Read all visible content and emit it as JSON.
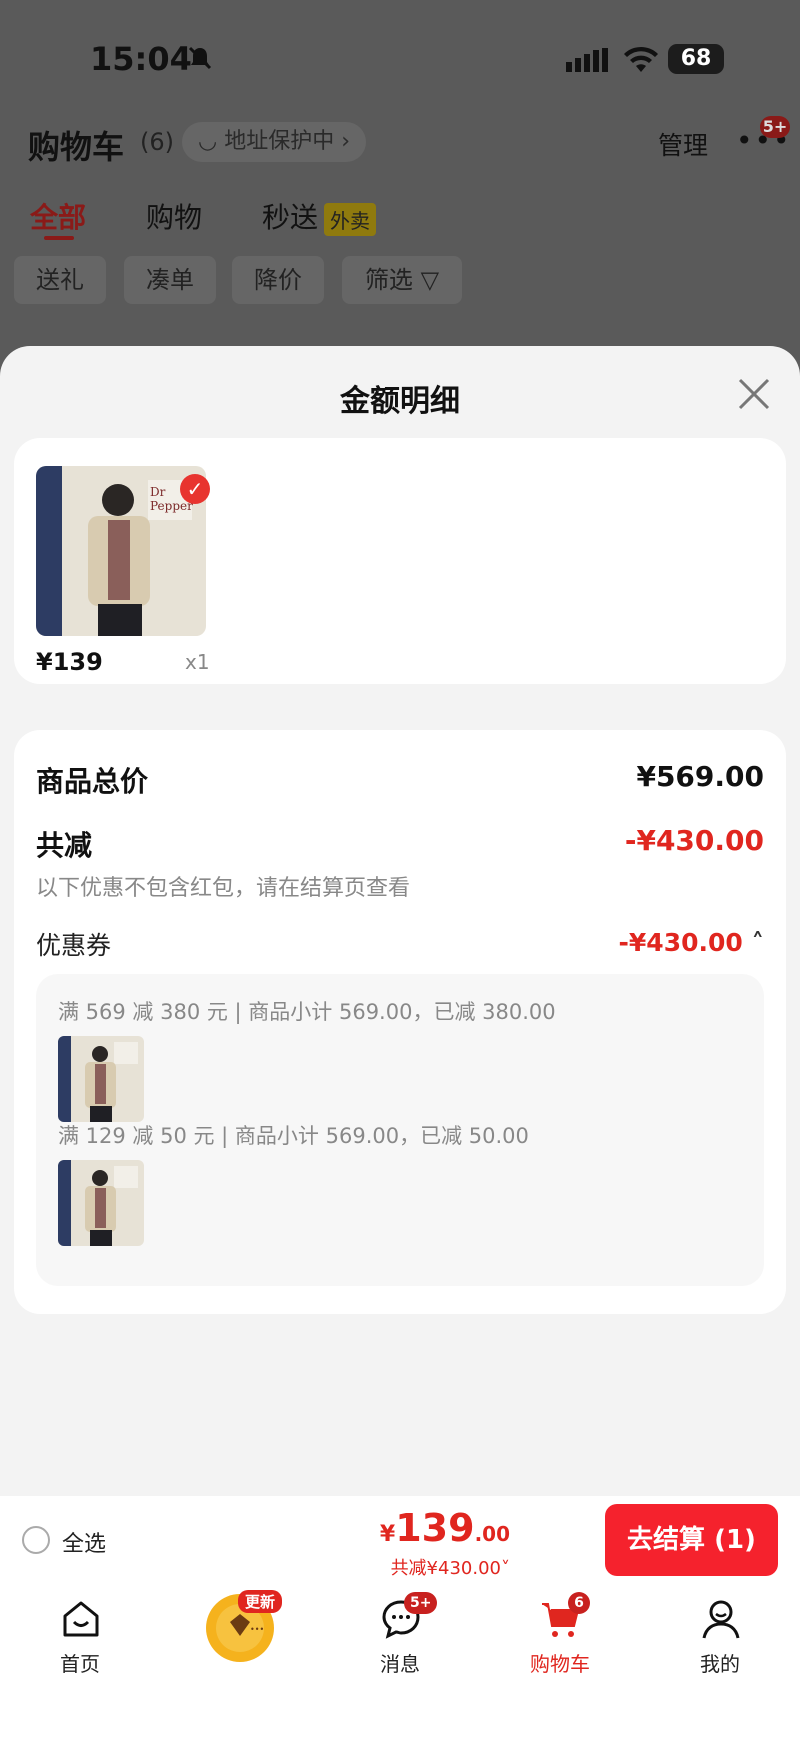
{
  "status_bar": {
    "time": "15:04",
    "battery": "68"
  },
  "header": {
    "title": "购物车",
    "count": "(6)",
    "address": "地址保护中",
    "manage": "管理",
    "more_badge": "5+"
  },
  "tabs": [
    {
      "label": "全部"
    },
    {
      "label": "购物"
    },
    {
      "label": "秒送"
    }
  ],
  "takeout_tag": "外卖",
  "chips": [
    {
      "label": "送礼"
    },
    {
      "label": "凑单"
    },
    {
      "label": "降价"
    },
    {
      "label": "筛选"
    }
  ],
  "sheet": {
    "title": "金额明细",
    "item": {
      "price": "¥139",
      "qty": "x1"
    },
    "summary": {
      "total_label": "商品总价",
      "total_value": "¥569.00",
      "reduce_label": "共减",
      "reduce_value": "-¥430.00",
      "note": "以下优惠不包含红包，请在结算页查看",
      "coupon_label": "优惠券",
      "coupon_value": "-¥430.00"
    },
    "coupons": [
      {
        "text": "满 569 减 380 元 | 商品小计 569.00，已减 380.00"
      },
      {
        "text": "满 129 减 50 元 | 商品小计 569.00，已减 50.00"
      }
    ]
  },
  "bottom_bar": {
    "select_all": "全选",
    "currency": "¥",
    "price_big": "139",
    "price_small": ".00",
    "reduce": "共减¥430.00",
    "checkout": "去结算 (1)"
  },
  "nav": {
    "items": [
      {
        "label": "首页"
      },
      {
        "label": ""
      },
      {
        "label": "消息"
      },
      {
        "label": "购物车"
      },
      {
        "label": "我的"
      }
    ],
    "update_badge": "更新",
    "message_badge": "5+",
    "cart_badge": "6"
  },
  "colors": {
    "accent": "#e0261f",
    "checkout_bg": "#f5222d",
    "logo_bg": "#f5b21d"
  }
}
